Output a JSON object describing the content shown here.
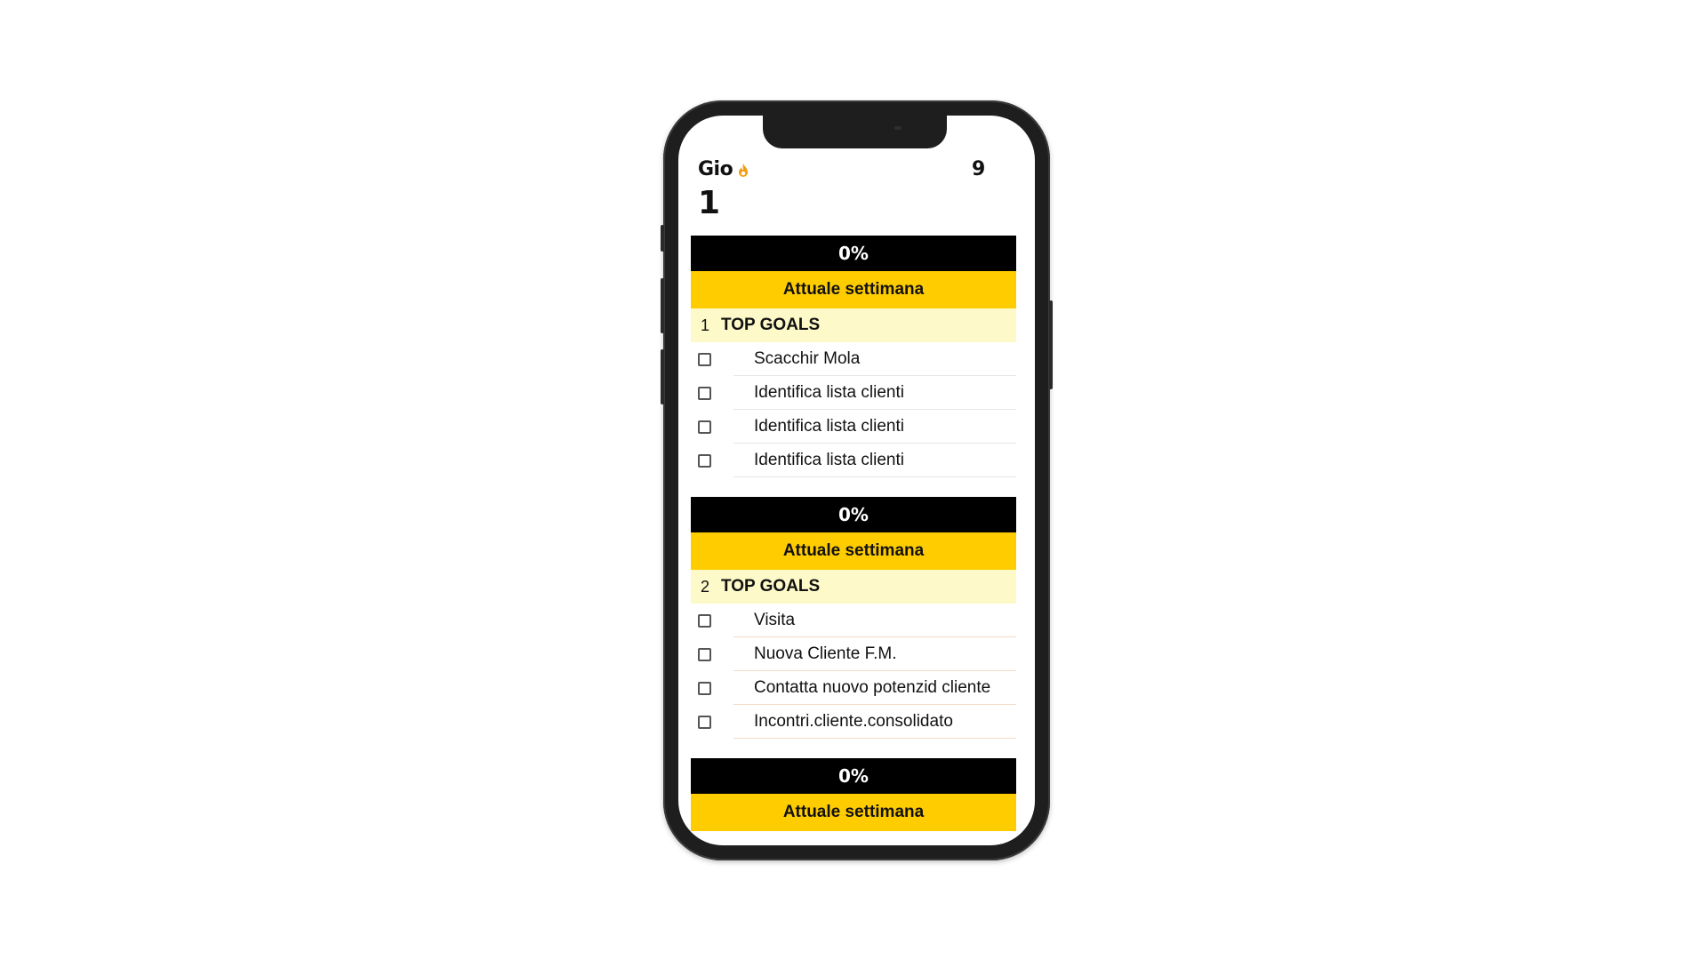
{
  "header": {
    "day_label": "Gio",
    "day_number": "1",
    "right_count": "9",
    "streak_icon": "flame-icon",
    "streak_color": "#f39c12"
  },
  "colors": {
    "bar_black": "#000000",
    "bar_yellow": "#ffcc00",
    "goals_bg": "#fdf9c8"
  },
  "sections": [
    {
      "percent": "0%",
      "week_label": "Attuale settimana",
      "goals_number": "1",
      "goals_title": "TOP GOALS",
      "tasks": [
        {
          "label": "Scacchir Mola",
          "checked": false
        },
        {
          "label": "Identifica lista clienti",
          "checked": false
        },
        {
          "label": "Identifica lista clienti",
          "checked": false
        },
        {
          "label": "Identifica lista clienti",
          "checked": false
        }
      ]
    },
    {
      "percent": "0%",
      "week_label": "Attuale settimana",
      "goals_number": "2",
      "goals_title": "TOP GOALS",
      "tasks": [
        {
          "label": "Visita",
          "checked": false
        },
        {
          "label": "Nuova Cliente F.M.",
          "checked": false
        },
        {
          "label": "Contatta nuovo potenzid cliente",
          "checked": false
        },
        {
          "label": "Incontri.cliente.consolidato",
          "checked": false
        }
      ]
    },
    {
      "percent": "0%",
      "week_label": "Attuale settimana"
    }
  ]
}
